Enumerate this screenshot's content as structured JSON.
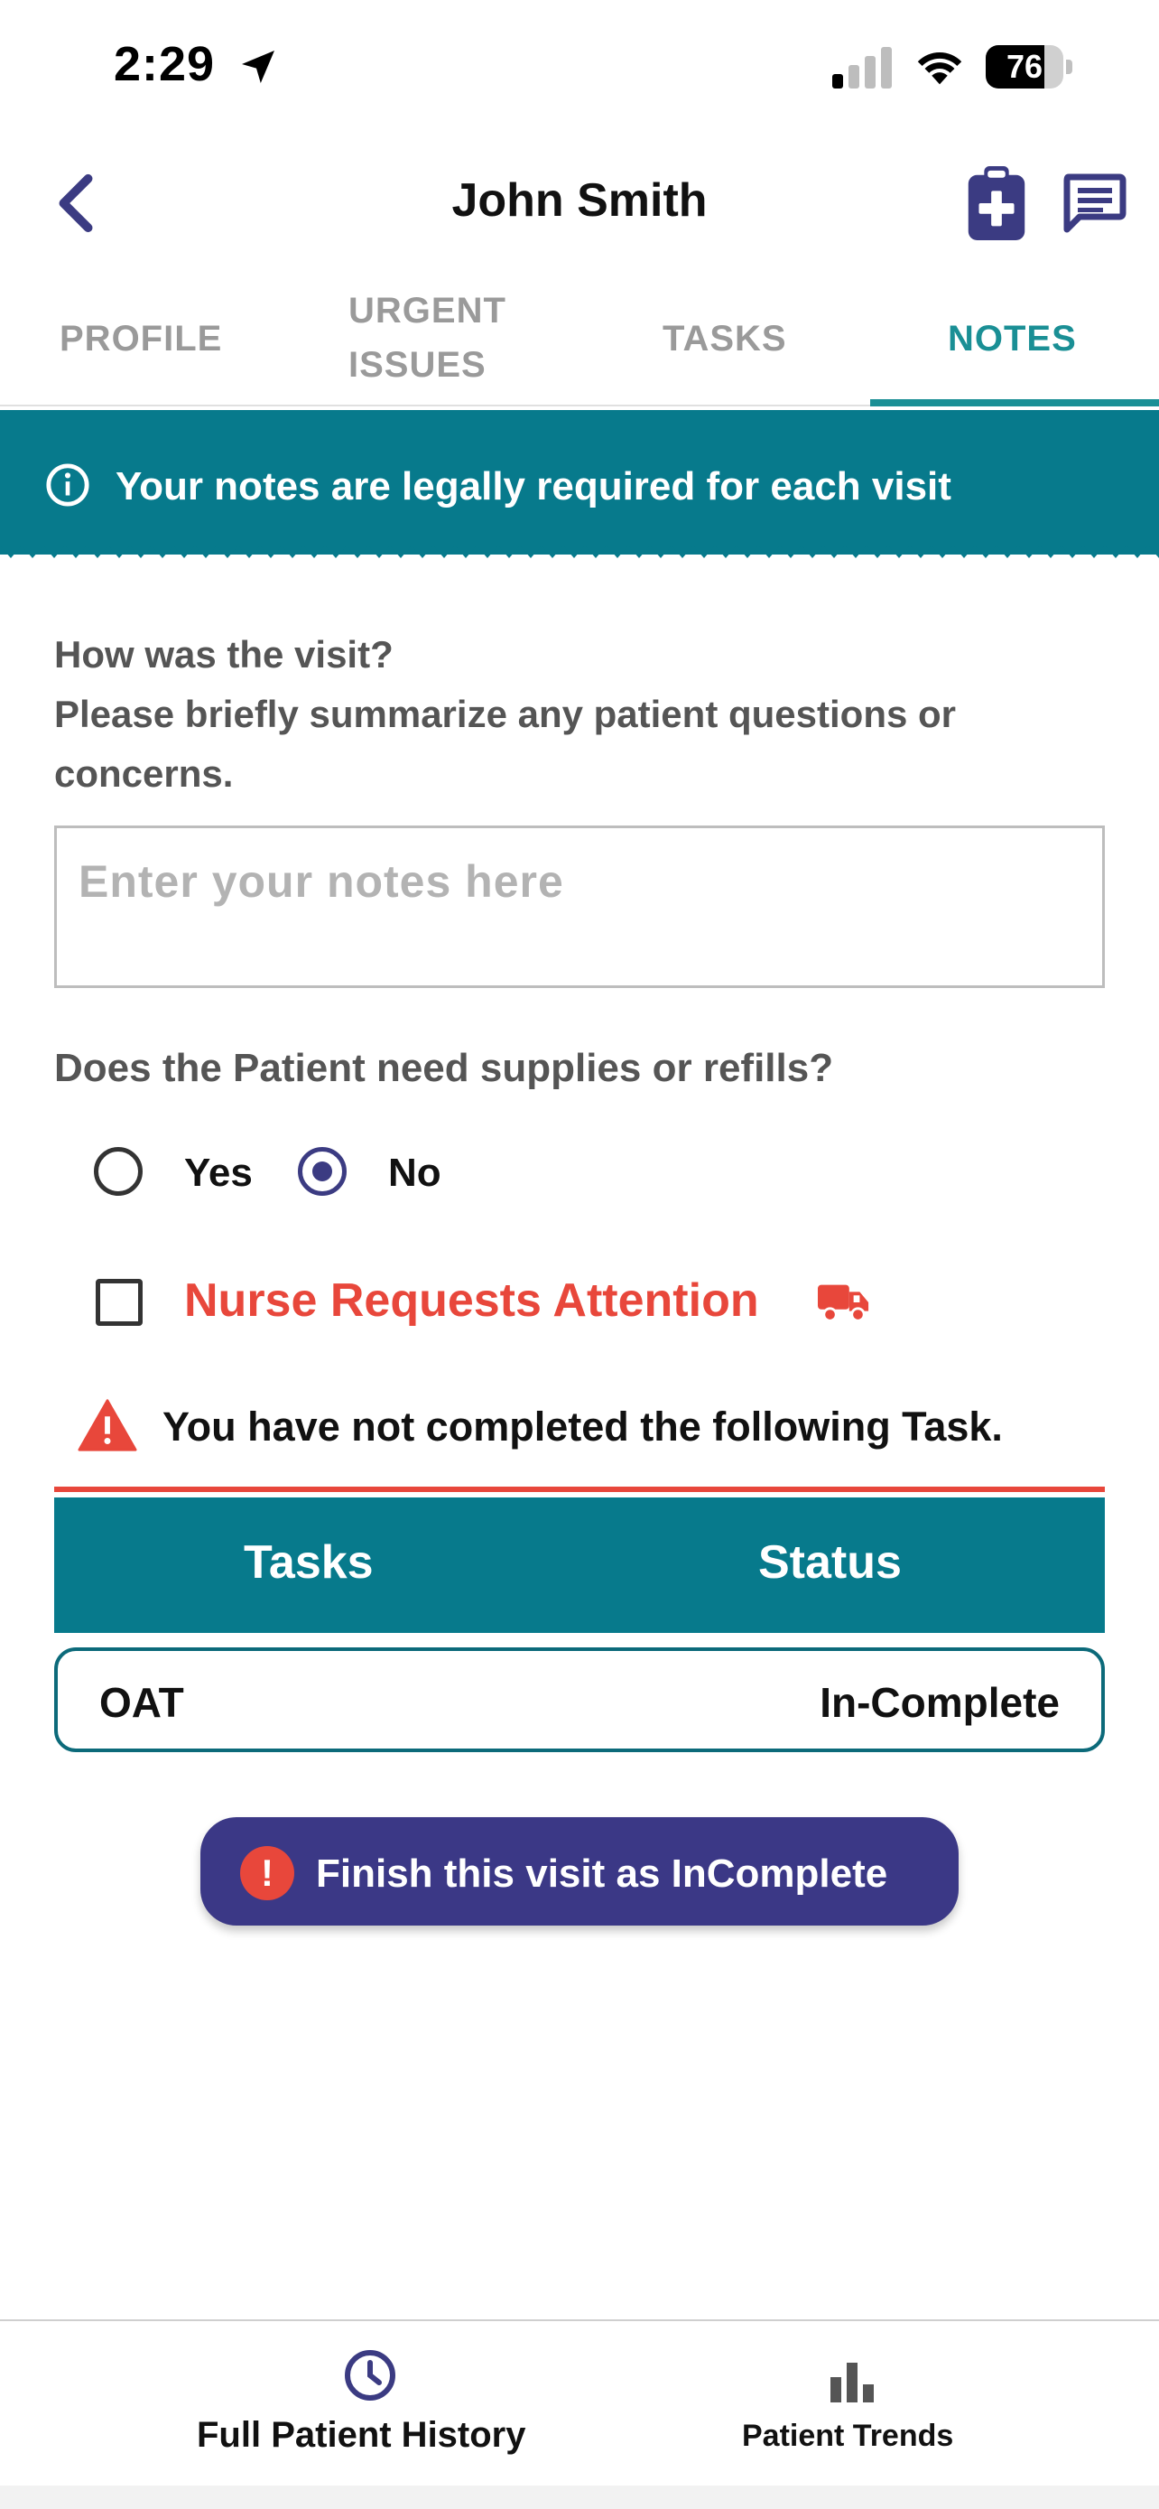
{
  "status_bar": {
    "time": "2:29",
    "battery_level": "76",
    "icons": [
      "location-arrow-icon",
      "signal-icon",
      "wifi-icon",
      "battery-icon"
    ]
  },
  "header": {
    "title": "John Smith",
    "icons": [
      "back-chevron-icon",
      "clipboard-medical-icon",
      "chat-icon"
    ]
  },
  "tabs": {
    "profile": "PROFILE",
    "urgent": "URGENT ISSUES",
    "tasks": "TASKS",
    "notes": "NOTES",
    "active": "NOTES"
  },
  "banner": {
    "text": "Your notes are legally required for each visit",
    "icon": "info-icon"
  },
  "notes_form": {
    "prompt_line1": "How was the visit?",
    "prompt_line2": "Please briefly summarize any patient questions or concerns.",
    "notes_placeholder": "Enter your notes here",
    "notes_value": "",
    "supplies_question": "Does the Patient need supplies or refills?",
    "yes_label": "Yes",
    "no_label": "No",
    "selected": "No",
    "nurse_attention_label": "Nurse Requests Attention",
    "nurse_attention_checked": false
  },
  "warning": {
    "text": "You have not completed the following Task.",
    "icon": "warning-triangle-icon"
  },
  "task_table": {
    "headers": [
      "Tasks",
      "Status"
    ],
    "rows": [
      {
        "task": "OAT",
        "status": "In-Complete"
      }
    ]
  },
  "finish_button": {
    "label": "Finish this visit as InComplete",
    "icon_glyph": "!"
  },
  "bottom_nav": {
    "history_label": "Full Patient History",
    "trends_label": "Patient Trends"
  },
  "colors": {
    "teal": "#077a8c",
    "active_tab": "#1a8f95",
    "alert_red": "#e8473b",
    "indigo": "#3b3886"
  }
}
